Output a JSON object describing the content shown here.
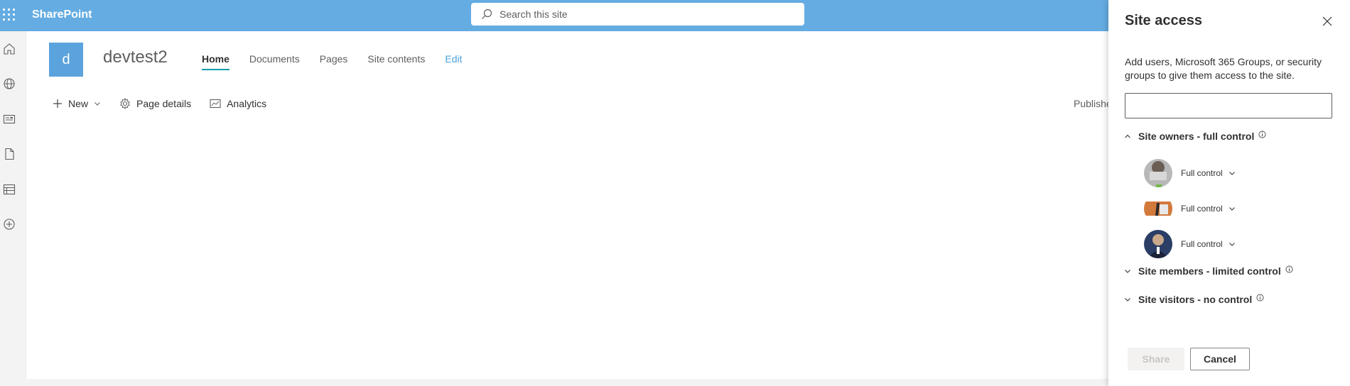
{
  "app": {
    "brand": "SharePoint"
  },
  "search": {
    "placeholder": "Search this site"
  },
  "rail": {
    "icons": [
      "home-icon",
      "globe-icon",
      "news-icon",
      "document-icon",
      "list-icon",
      "add-circle-icon"
    ]
  },
  "site": {
    "logo_letter": "d",
    "title": "devtest2",
    "nav": [
      {
        "label": "Home",
        "active": true
      },
      {
        "label": "Documents"
      },
      {
        "label": "Pages"
      },
      {
        "label": "Site contents"
      },
      {
        "label": "Edit"
      }
    ]
  },
  "commandbar": {
    "new_label": "New",
    "page_details_label": "Page details",
    "analytics_label": "Analytics",
    "published_label": "Publishe"
  },
  "panel": {
    "title": "Site access",
    "description": "Add users, Microsoft 365 Groups, or security groups to give them access to the site.",
    "input_value": "",
    "groups": [
      {
        "label": "Site owners - full control",
        "expanded": true
      },
      {
        "label": "Site members - limited control",
        "expanded": false
      },
      {
        "label": "Site visitors - no control",
        "expanded": false
      }
    ],
    "owners": [
      {
        "permission": "Full control"
      },
      {
        "permission": "Full control"
      },
      {
        "permission": "Full control"
      }
    ],
    "share_label": "Share",
    "cancel_label": "Cancel"
  },
  "colors": {
    "suite_bar": "#64ace2",
    "site_logo": "#5ba3dd",
    "nav_underline": "#0e9fa9"
  }
}
